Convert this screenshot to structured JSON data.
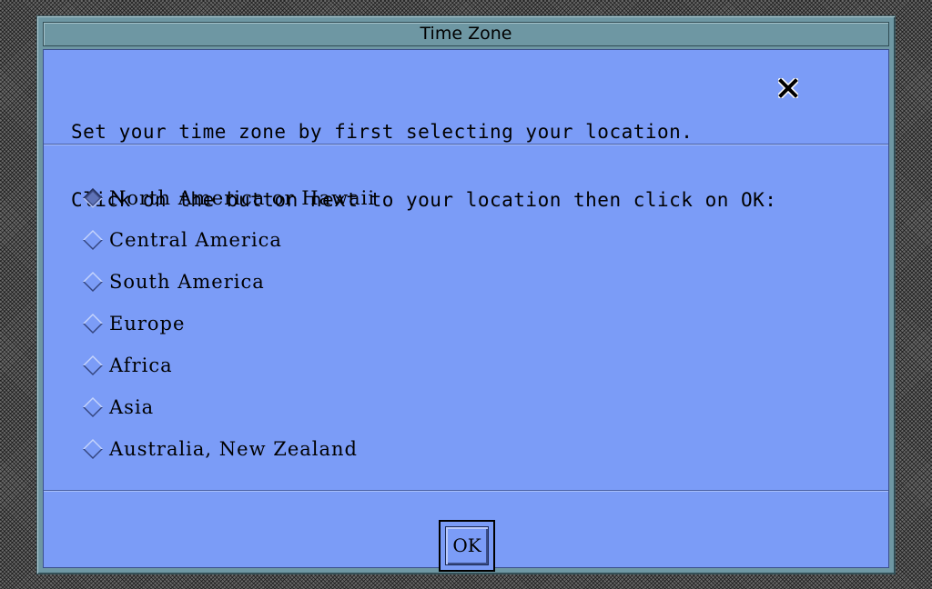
{
  "window": {
    "title": "Time Zone"
  },
  "instructions": {
    "line1": "Set your time zone by first selecting your location.",
    "line2": "Click on the button next to your location then click on OK:"
  },
  "regions": [
    {
      "label": "North America or Hawaii",
      "selected": true
    },
    {
      "label": "Central America",
      "selected": false
    },
    {
      "label": "South America",
      "selected": false
    },
    {
      "label": "Europe",
      "selected": false
    },
    {
      "label": "Africa",
      "selected": false
    },
    {
      "label": "Asia",
      "selected": false
    },
    {
      "label": "Australia, New Zealand",
      "selected": false
    }
  ],
  "ok_button": {
    "label": "OK"
  },
  "colors": {
    "client_background": "#7b9cf7",
    "frame": "#6e97a3",
    "desktop": "#6a6a6a"
  },
  "icons": {
    "pointer": "x-cursor-icon",
    "radio": "diamond-radio-icon"
  }
}
